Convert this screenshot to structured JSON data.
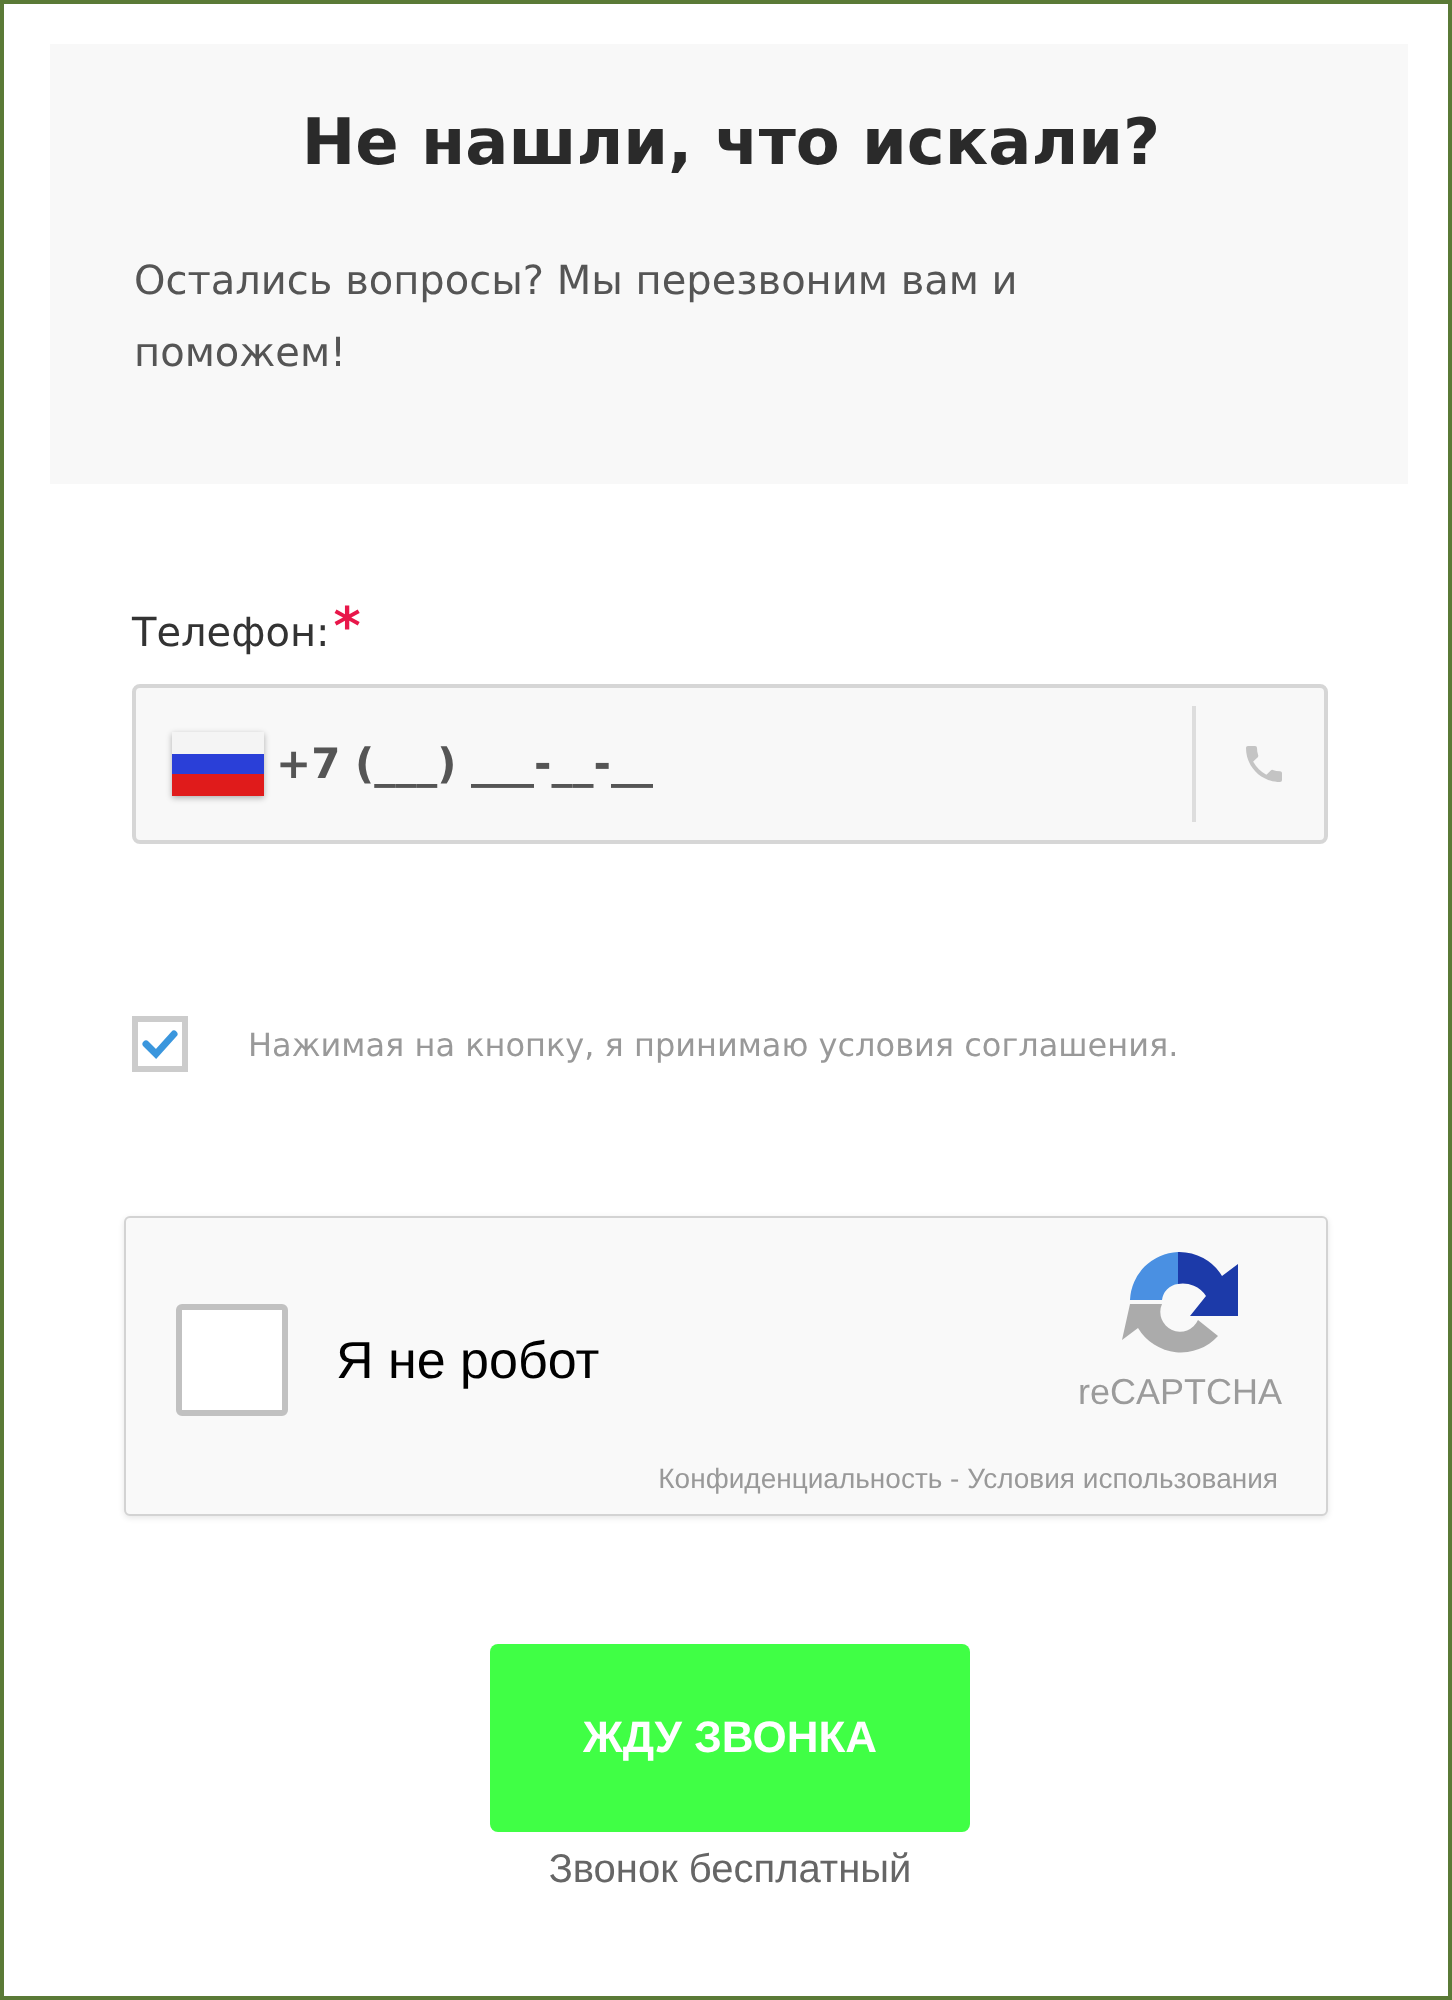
{
  "header": {
    "title": "Не нашли, что искали?",
    "subtitle": "Остались вопросы? Мы перезвоним вам и поможем!"
  },
  "phone": {
    "label": "Телефон:",
    "required_mark": "*",
    "value": "+7 (___) ___-__-__"
  },
  "agreement": {
    "checked": true,
    "text": "Нажимая на кнопку, я принимаю условия соглашения."
  },
  "captcha": {
    "checked": false,
    "label": "Я не робот",
    "brand": "reCAPTCHA",
    "privacy_link": "Конфиденциальность",
    "separator": " - ",
    "terms_link": "Условия использования"
  },
  "submit": {
    "label": "ЖДУ ЗВОНКА",
    "note": "Звонок бесплатный"
  }
}
